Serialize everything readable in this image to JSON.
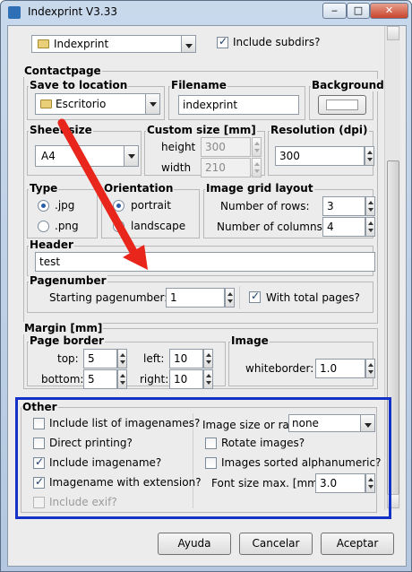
{
  "window": {
    "title": "Indexprint V3.33",
    "minimize": "‒",
    "maximize": "□",
    "close": "✕"
  },
  "top_row": {
    "folder_value": "Indexprint",
    "include_subdirs_label": "Include subdirs?",
    "include_subdirs_checked": true
  },
  "contactpage": {
    "title": "Contactpage",
    "save_to_location": {
      "title": "Save to location",
      "value": "Escritorio"
    },
    "filename": {
      "title": "Filename",
      "value": "indexprint"
    },
    "background": {
      "title": "Background"
    },
    "sheet_size": {
      "title": "Sheet size",
      "value": "A4"
    },
    "custom_size": {
      "title": "Custom size [mm]",
      "height_label": "height",
      "height_value": "300",
      "width_label": "width",
      "width_value": "210"
    },
    "resolution": {
      "title": "Resolution (dpi)",
      "value": "300"
    },
    "type": {
      "title": "Type",
      "options": [
        {
          "label": ".jpg",
          "checked": true
        },
        {
          "label": ".png",
          "checked": false
        }
      ]
    },
    "orientation": {
      "title": "Orientation",
      "options": [
        {
          "label": "portrait",
          "checked": true
        },
        {
          "label": "landscape",
          "checked": false
        }
      ]
    },
    "grid": {
      "title": "Image grid layout",
      "rows_label": "Number of rows:",
      "rows_value": "3",
      "cols_label": "Number of columns:",
      "cols_value": "4"
    },
    "header": {
      "title": "Header",
      "value": "test"
    },
    "pagenumber": {
      "title": "Pagenumber",
      "start_label": "Starting pagenumber:",
      "start_value": "1",
      "total_label": "With total pages?",
      "total_checked": true
    }
  },
  "margin": {
    "title": "Margin [mm]",
    "page_border": {
      "title": "Page border",
      "top_label": "top:",
      "top_value": "5",
      "left_label": "left:",
      "left_value": "10",
      "bottom_label": "bottom:",
      "bottom_value": "5",
      "right_label": "right:",
      "right_value": "10"
    },
    "image": {
      "title": "Image",
      "whiteborder_label": "whiteborder:",
      "whiteborder_value": "1.0"
    }
  },
  "other": {
    "title": "Other",
    "left_options": [
      {
        "label": "Include list of imagenames?",
        "checked": false,
        "disabled": false
      },
      {
        "label": "Direct printing?",
        "checked": false,
        "disabled": false
      },
      {
        "label": "Include imagename?",
        "checked": true,
        "disabled": false
      },
      {
        "label": "Imagename with extension?",
        "checked": true,
        "disabled": false
      },
      {
        "label": "Include exif?",
        "checked": false,
        "disabled": true
      }
    ],
    "size_ratio_label": "Image size or ratio",
    "size_ratio_value": "none",
    "rotate_label": "Rotate images?",
    "rotate_checked": false,
    "sorted_label": "Images sorted alphanumeric?",
    "sorted_checked": false,
    "font_size_label": "Font size max. [mm]",
    "font_size_value": "3.0"
  },
  "buttons": {
    "help": "Ayuda",
    "cancel": "Cancelar",
    "accept": "Aceptar"
  },
  "colors": {
    "arrow": "#e8261c",
    "highlight": "#1431c8"
  }
}
